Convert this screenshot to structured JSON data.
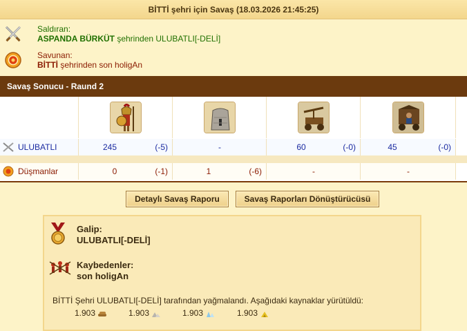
{
  "header": {
    "title": "BİTTİ şehri için Savaş (18.03.2026 21:45:25)"
  },
  "attacker": {
    "role": "Saldıran:",
    "name": "ASPANDA BÜRKÜT",
    "suffix": " şehrinden ULUBATLI[-DELİ]",
    "icon": "crossed-swords-icon"
  },
  "defender": {
    "role": "Savunan:",
    "name": "BİTTİ",
    "suffix": " şehrinden son holigAn",
    "icon": "shield-emblem-icon"
  },
  "section": {
    "title": "Savaş Sonucu - Raund 2"
  },
  "units": [
    {
      "icon": "spearman-hoplite-icon"
    },
    {
      "icon": "stone-wall-icon"
    },
    {
      "icon": "catapult-icon"
    },
    {
      "icon": "siege-ram-icon"
    }
  ],
  "rows": {
    "attacker": {
      "label": "ULUBATLI",
      "cells": [
        {
          "count": "245",
          "delta": "(-5)"
        },
        {
          "count": "-",
          "delta": ""
        },
        {
          "count": "60",
          "delta": "(-0)"
        },
        {
          "count": "45",
          "delta": "(-0)"
        }
      ]
    },
    "defender": {
      "label": "Düşmanlar",
      "cells": [
        {
          "count": "0",
          "delta": "(-1)"
        },
        {
          "count": "1",
          "delta": "(-6)"
        },
        {
          "count": "-",
          "delta": ""
        },
        {
          "count": "-",
          "delta": ""
        }
      ]
    }
  },
  "buttons": {
    "detailed_report": "Detaylı Savaş Raporu",
    "converter": "Savaş Raporları Dönüştürücüsü"
  },
  "result": {
    "winner_label": "Galip:",
    "winner_name": "ULUBATLI[-DELİ]",
    "losers_label": "Kaybedenler:",
    "losers_name": "son holigAn",
    "loot_text": "BİTTİ Şehri ULUBATLI[-DELİ] tarafından yağmalandı. Aşağıdaki kaynaklar yürütüldü:",
    "resources": [
      {
        "amount": "1.903",
        "icon": "wood-icon"
      },
      {
        "amount": "1.903",
        "icon": "marble-icon"
      },
      {
        "amount": "1.903",
        "icon": "crystal-icon"
      },
      {
        "amount": "1.903",
        "icon": "sulfur-icon"
      }
    ]
  },
  "colors": {
    "section_bar": "#6b3a0e",
    "attacker_text": "#207000",
    "defender_text": "#8a1a00",
    "value_blue": "#1a2aa0",
    "background": "#fdf3c8"
  }
}
